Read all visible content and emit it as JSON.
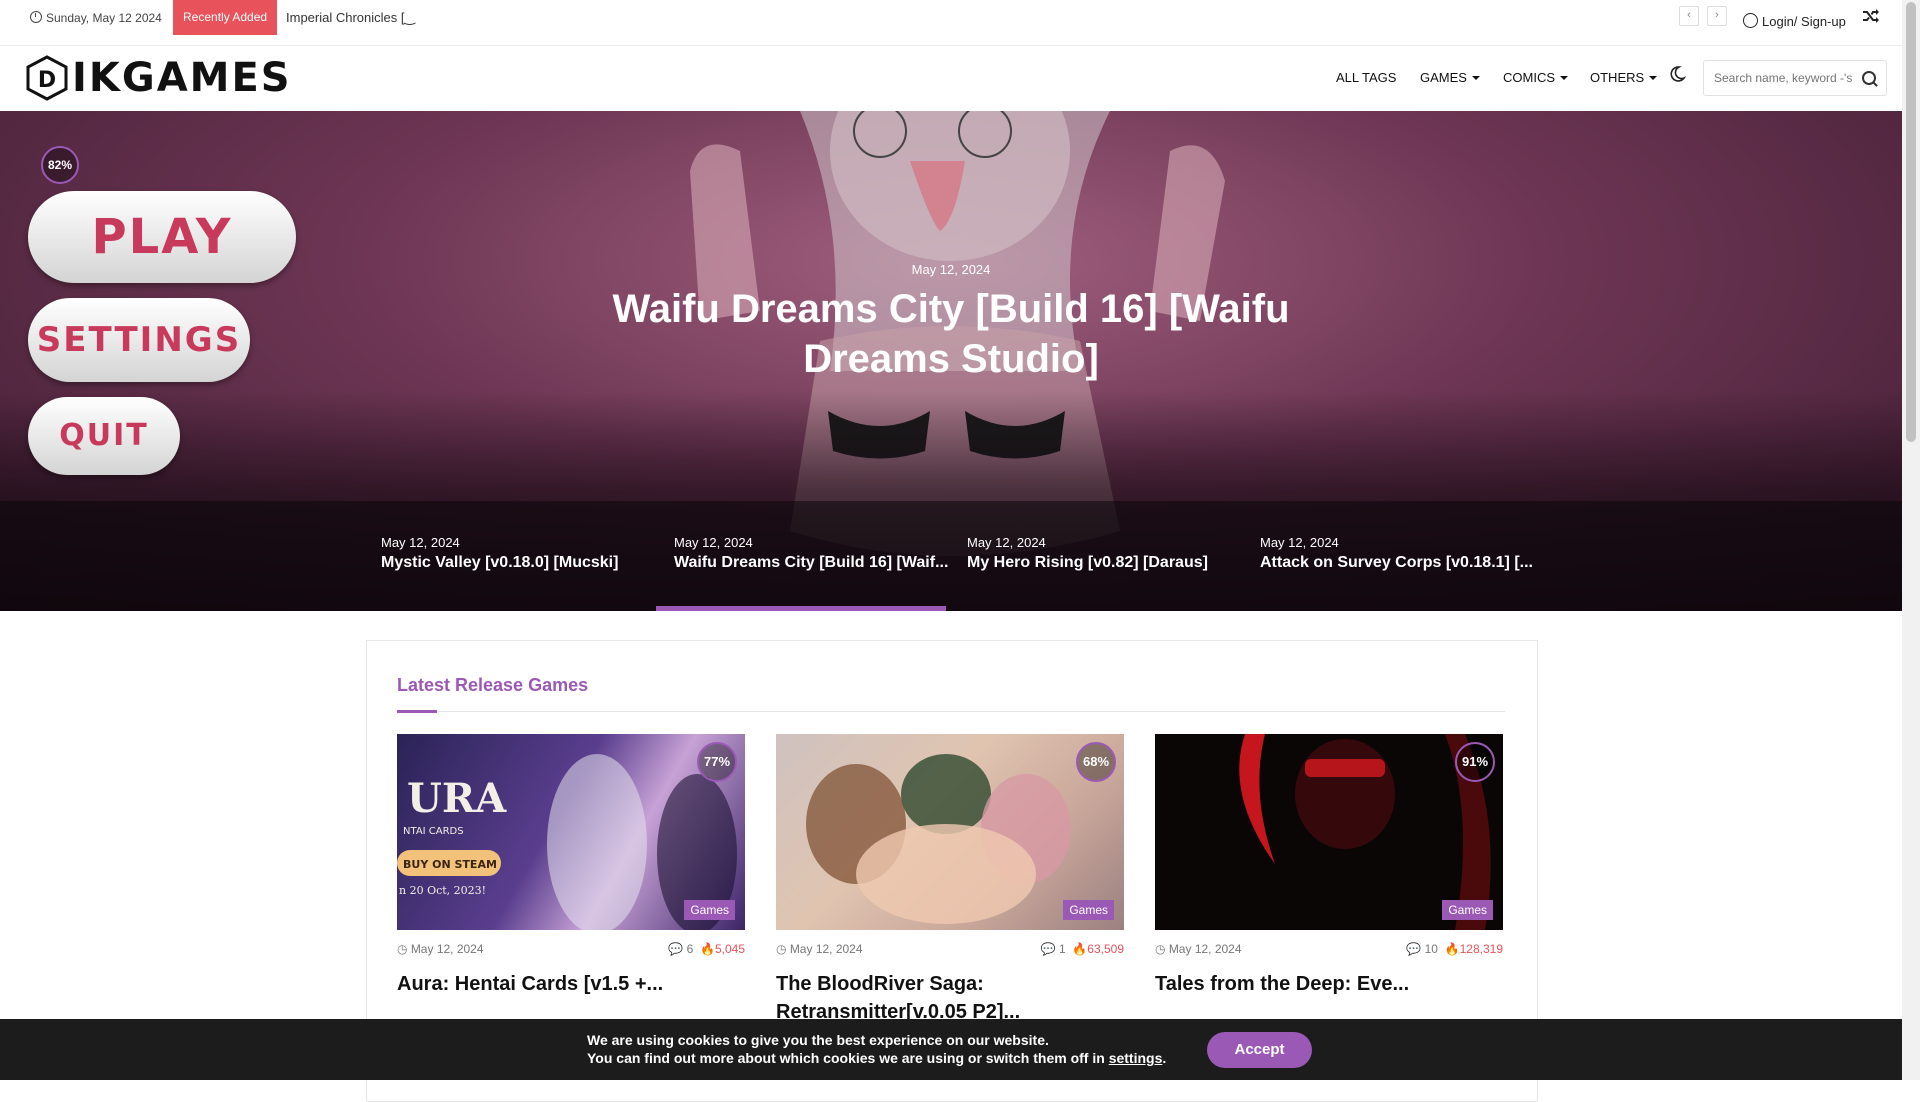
{
  "topbar": {
    "date": "Sunday, May 12 2024",
    "recent_label": "Recently Added",
    "ticker": "Imperial Chronicles [‿",
    "prev_arrow": "‹",
    "next_arrow": "›",
    "login": "Login/ Sign-up"
  },
  "header": {
    "logo_letter": "D",
    "logo_text": "IKGAMES",
    "nav": [
      "ALL TAGS",
      "GAMES",
      "COMICS",
      "OTHERS"
    ],
    "search_placeholder": "Search name, keyword -'s"
  },
  "hero": {
    "date": "May 12, 2024",
    "title": "Waifu Dreams City [Build 16] [Waifu Dreams Studio]",
    "rating": "82%",
    "game_menu": [
      "PLAY",
      "SETTINGS",
      "QUIT"
    ],
    "slides": [
      {
        "date": "May 12, 2024",
        "title": "Mystic Valley [v0.18.0] [Mucski]"
      },
      {
        "date": "May 12, 2024",
        "title": "Waifu Dreams City [Build 16] [Waif..."
      },
      {
        "date": "May 12, 2024",
        "title": "My Hero Rising [v0.82] [Daraus]"
      },
      {
        "date": "May 12, 2024",
        "title": "Attack on Survey Corps [v0.18.1] [..."
      }
    ],
    "active_slide": 1
  },
  "latest": {
    "title": "Latest Release Games",
    "cards": [
      {
        "rating": "77%",
        "badge": "Games",
        "date": "May 12, 2024",
        "comments": "6",
        "views": "5,045",
        "title": "Aura: Hentai Cards [v1.5 +...",
        "thumb_text1": "URA",
        "thumb_text2": "NTAI CARDS",
        "thumb_btn": "BUY ON STEAM",
        "thumb_text3": "n 20 Oct, 2023!"
      },
      {
        "rating": "68%",
        "badge": "Games",
        "date": "May 12, 2024",
        "comments": "1",
        "views": "63,509",
        "title": "The BloodRiver Saga: Retransmitter[v.0.05 P2]..."
      },
      {
        "rating": "91%",
        "badge": "Games",
        "date": "May 12, 2024",
        "comments": "10",
        "views": "128,319",
        "title": "Tales from the Deep: Eve..."
      }
    ]
  },
  "cookie": {
    "line1": "We are using cookies to give you the best experience on our website.",
    "line2": "You can find out more about which cookies we are using or switch them off in ",
    "link": "settings",
    "line2_end": ".",
    "accept": "Accept"
  },
  "colors": {
    "accent": "#9b59b6",
    "recent": "#e8525a",
    "hot": "#e8525a"
  }
}
